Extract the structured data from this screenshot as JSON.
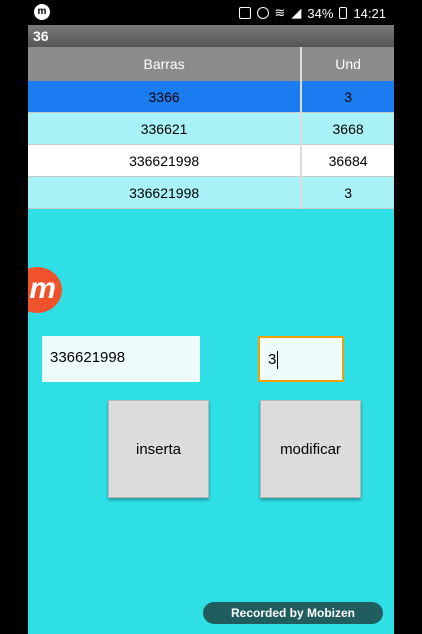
{
  "status": {
    "battery_pct": "34%",
    "time": "14:21",
    "notification_logo": "m",
    "icons": [
      "sim-icon",
      "alarm-icon",
      "wifi-icon",
      "signal-icon",
      "battery-icon"
    ]
  },
  "app": {
    "title": "36"
  },
  "table": {
    "headers": [
      "Barras",
      "Und"
    ],
    "rows": [
      {
        "barras": "3366",
        "und": "3",
        "selected": true
      },
      {
        "barras": "336621",
        "und": "3668"
      },
      {
        "barras": "336621998",
        "und": "36684"
      },
      {
        "barras": "336621998",
        "und": "3"
      }
    ]
  },
  "floating_logo": "m",
  "form": {
    "barras_value": "336621998",
    "und_value": "3",
    "insert_label": "inserta",
    "modify_label": "modificar"
  },
  "watermark": {
    "text": "Recorded by Mobizen"
  },
  "colors": {
    "background": "#2ee0e6",
    "selected_row": "#1a7cf0",
    "accent": "#f0a000",
    "logo": "#f0532b"
  }
}
